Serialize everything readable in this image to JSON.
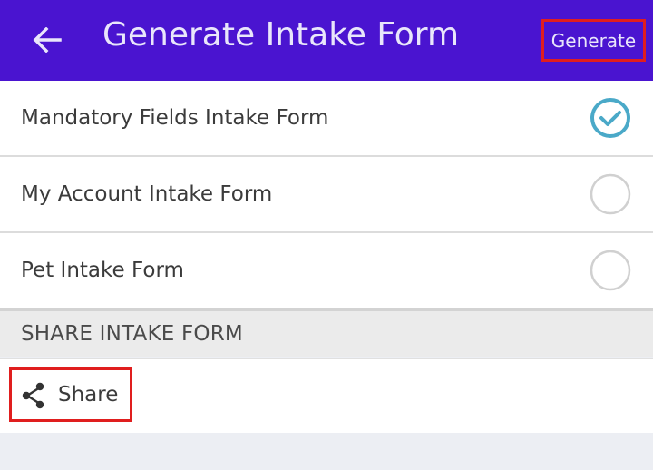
{
  "appbar": {
    "back_icon": "arrow-left-icon",
    "title": "Generate Intake Form",
    "generate_label": "Generate",
    "background_color": "#4a14d0"
  },
  "forms": [
    {
      "label": "Mandatory Fields Intake Form",
      "selected": true
    },
    {
      "label": "My Account Intake Form",
      "selected": false
    },
    {
      "label": "Pet Intake Form",
      "selected": false
    }
  ],
  "share_section": {
    "header": "SHARE INTAKE FORM",
    "share_label": "Share",
    "share_icon": "share-icon"
  },
  "colors": {
    "check_accent": "#4aa9c8",
    "highlight_box": "#e01e1e"
  }
}
